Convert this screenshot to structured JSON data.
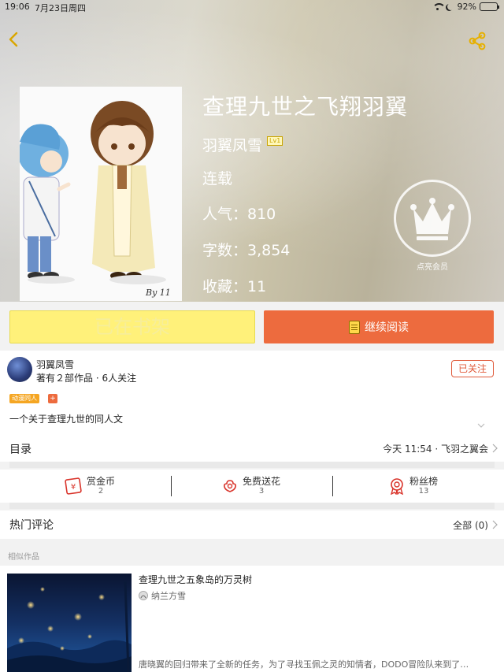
{
  "status_bar": {
    "time": "19:06",
    "date": "7月23日周四",
    "battery": "92%",
    "battery_level": 0.92
  },
  "book": {
    "title": "查理九世之飞翔羽翼",
    "author": "羽翼凤雪",
    "author_level": "Lv1",
    "status": "连载",
    "popularity": "人气：810",
    "word_count": "字数：3,854",
    "favorites": "收藏：11",
    "cover_signature": "By 11"
  },
  "crown_badge": {
    "label": "点亮会员",
    "icon": "crown-icon"
  },
  "actions": {
    "shelf_label": "已在书架",
    "read_label": "继续阅读"
  },
  "author_section": {
    "name": "羽翼凤雪",
    "stats": "著有２部作品 · 6人关注",
    "follow_label": "已关注",
    "tag": "动漫同人",
    "tag_add": "+",
    "synopsis": "一个关于查理九世的同人文"
  },
  "catalog": {
    "label": "目录",
    "latest_update": "今天 11:54 · 飞羽之翼会"
  },
  "stats": [
    {
      "label": "赏金币",
      "count": "2",
      "icon": "red-envelope-icon"
    },
    {
      "label": "免费送花",
      "count": "3",
      "icon": "flower-icon"
    },
    {
      "label": "粉丝榜",
      "count": "13",
      "icon": "medal-icon"
    }
  ],
  "comments": {
    "label": "热门评论",
    "all_label": "全部 (0)"
  },
  "similar": {
    "heading": "相似作品",
    "items": [
      {
        "title": "查理九世之五象岛的万灵树",
        "author": "纳兰方雪",
        "description": "唐晓翼的回归带来了全新的任务，为了寻找玉佩之灵的知情者，DODO冒险队来到了…"
      }
    ]
  },
  "colors": {
    "accent": "#ed6b3e",
    "shelf": "#fff17a",
    "tag": "#f5a623"
  }
}
